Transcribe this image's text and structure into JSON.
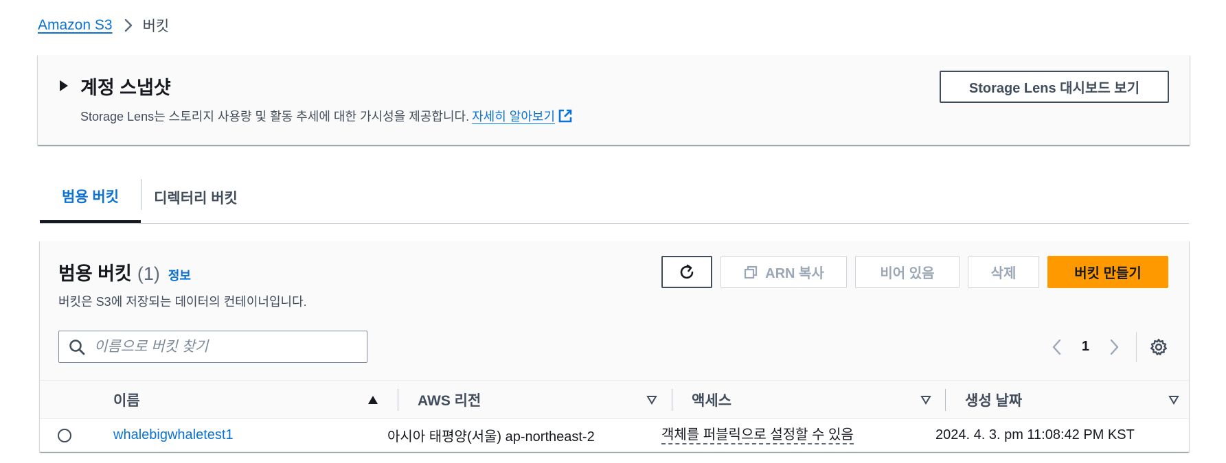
{
  "breadcrumb": {
    "root": "Amazon S3",
    "current": "버킷"
  },
  "snapshot": {
    "title": "계정 스냅샷",
    "description": "Storage Lens는 스토리지 사용량 및 활동 추세에 대한 가시성을 제공합니다.",
    "learn_more": "자세히 알아보기",
    "lens_button": "Storage Lens 대시보드 보기"
  },
  "tabs": [
    {
      "label": "범용 버킷",
      "active": true
    },
    {
      "label": "디렉터리 버킷",
      "active": false
    }
  ],
  "buckets_panel": {
    "title": "범용 버킷",
    "count": "(1)",
    "info": "정보",
    "description": "버킷은 S3에 저장되는 데이터의 컨테이너입니다.",
    "actions": {
      "copy_arn": "ARN 복사",
      "empty": "비어 있음",
      "delete": "삭제",
      "create": "버킷 만들기"
    },
    "search_placeholder": "이름으로 버킷 찾기",
    "pagination": {
      "current_page": "1"
    }
  },
  "table": {
    "columns": [
      "이름",
      "AWS 리전",
      "액세스",
      "생성 날짜"
    ],
    "rows": [
      {
        "name": "whalebigwhaletest1",
        "region": "아시아 태평양(서울) ap-northeast-2",
        "access": "객체를 퍼블릭으로 설정할 수 있음",
        "created": "2024. 4. 3. pm 11:08:42 PM KST"
      }
    ]
  },
  "colors": {
    "link": "#0972d3",
    "primary_button": "#ff9900",
    "text": "#16191f",
    "disabled": "#9ba7b6"
  }
}
